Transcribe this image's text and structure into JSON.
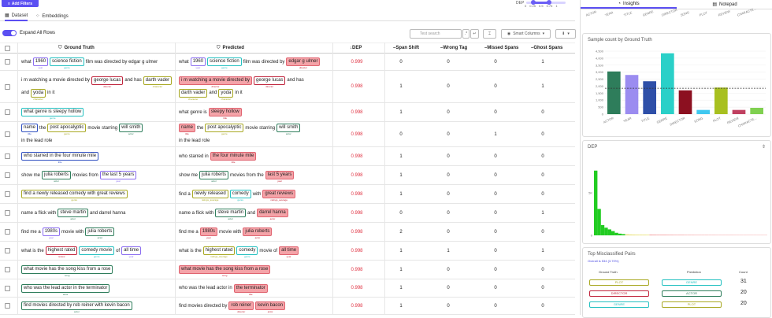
{
  "top": {
    "add_filters": "Add Filters",
    "dep_label": "DEP",
    "dep_ticks": [
      "0",
      "0.25",
      "0.5",
      "0.75",
      "1"
    ],
    "dep_range": [
      0.25,
      0.75
    ]
  },
  "tabs": [
    {
      "label": "Dataset",
      "icon": "table-icon"
    },
    {
      "label": "Embeddings",
      "icon": "embeddings-icon"
    }
  ],
  "toolbar": {
    "expand_label": "Expand All Rows",
    "search_placeholder": "Test search",
    "smart_columns": "Smart Columns"
  },
  "columns": {
    "ground_truth": "Ground Truth",
    "predicted": "Predicted",
    "dep": "DEP",
    "span_shift": "Span Shift",
    "wrong_tag": "Wrong Tag",
    "missed_spans": "Missed Spans",
    "ghost_spans": "Ghost Spans"
  },
  "rows": [
    {
      "gt": [
        [
          "t",
          "what"
        ],
        [
          "s",
          "1960",
          "year",
          "#8a6cf0"
        ],
        [
          "s",
          "science fiction",
          "genre",
          "#23c0c0"
        ],
        [
          "t",
          "film was directed by edgar g ulmer"
        ]
      ],
      "pr": [
        [
          "t",
          "what"
        ],
        [
          "s",
          "1960",
          "year",
          "#8a6cf0"
        ],
        [
          "s",
          "science fiction",
          "genre",
          "#23c0c0"
        ],
        [
          "t",
          "film was directed by"
        ],
        [
          "e",
          "edgar g ulmer",
          "director"
        ]
      ],
      "dep": "0.999",
      "ss": "0",
      "wt": "0",
      "ms": "0",
      "gs": "1"
    },
    {
      "gt": [
        [
          "t",
          "i m watching a movie directed by"
        ],
        [
          "s",
          "george lucas",
          "director",
          "#c0243c"
        ],
        [
          "t",
          "and has"
        ],
        [
          "s",
          "darth vader",
          "character",
          "#a8a822"
        ],
        [
          "t",
          "and"
        ],
        [
          "s",
          "yoda",
          "character",
          "#a8a822"
        ],
        [
          "t",
          "in it"
        ]
      ],
      "pr": [
        [
          "e",
          "i m watching a movie directed by",
          "director"
        ],
        [
          "s",
          "george lucas",
          "director",
          "#c0243c"
        ],
        [
          "t",
          "and has"
        ],
        [
          "s",
          "darth vader",
          "character",
          "#a8a822"
        ],
        [
          "t",
          "and"
        ],
        [
          "s",
          "yoda",
          "character",
          "#a8a822"
        ],
        [
          "t",
          "in it"
        ]
      ],
      "dep": "0.998",
      "ss": "1",
      "wt": "0",
      "ms": "0",
      "gs": "1"
    },
    {
      "gt": [
        [
          "s",
          "what genre is sleepy hollow",
          "genre",
          "#23c0c0"
        ]
      ],
      "pr": [
        [
          "t",
          "what genre is"
        ],
        [
          "e",
          "sleepy hollow",
          "title"
        ]
      ],
      "dep": "0.998",
      "ss": "1",
      "wt": "0",
      "ms": "0",
      "gs": "0"
    },
    {
      "gt": [
        [
          "s",
          "name",
          "title",
          "#3050c0"
        ],
        [
          "t",
          "the"
        ],
        [
          "s",
          "post apocalyptic",
          "genre",
          "#a8a822"
        ],
        [
          "t",
          "movie starring"
        ],
        [
          "s",
          "will smith",
          "actor",
          "#2e7d5b"
        ],
        [
          "t",
          "in the lead role"
        ]
      ],
      "pr": [
        [
          "e",
          "name",
          "title"
        ],
        [
          "t",
          "the"
        ],
        [
          "s",
          "post apocalyptic",
          "genre",
          "#a8a822"
        ],
        [
          "t",
          "movie starring"
        ],
        [
          "s",
          "will smith",
          "actor",
          "#2e7d5b"
        ],
        [
          "t",
          "in the lead role"
        ]
      ],
      "dep": "0.998",
      "ss": "0",
      "wt": "0",
      "ms": "1",
      "gs": "0"
    },
    {
      "gt": [
        [
          "s",
          "who starred in the four minute mile",
          "title",
          "#3050c0"
        ]
      ],
      "pr": [
        [
          "t",
          "who starred in"
        ],
        [
          "e",
          "the four minute mile",
          "title"
        ]
      ],
      "dep": "0.998",
      "ss": "1",
      "wt": "0",
      "ms": "0",
      "gs": "0"
    },
    {
      "gt": [
        [
          "t",
          "show me"
        ],
        [
          "s",
          "julia roberts",
          "actor",
          "#2e7d5b"
        ],
        [
          "t",
          "movies from"
        ],
        [
          "s",
          "the last 5 years",
          "year",
          "#8a6cf0"
        ]
      ],
      "pr": [
        [
          "t",
          "show me"
        ],
        [
          "s",
          "julia roberts",
          "actor",
          "#2e7d5b"
        ],
        [
          "t",
          "movies from the"
        ],
        [
          "e",
          "last 5 years",
          "year"
        ]
      ],
      "dep": "0.998",
      "ss": "1",
      "wt": "0",
      "ms": "0",
      "gs": "0"
    },
    {
      "gt": [
        [
          "s",
          "find a newly released comedy with great reviews",
          "genre",
          "#a8a822"
        ]
      ],
      "pr": [
        [
          "t",
          "find a"
        ],
        [
          "s",
          "newly released",
          "ratings_average",
          "#a8a822"
        ],
        [
          "s",
          "comedy",
          "genre",
          "#23c0c0"
        ],
        [
          "t",
          "with"
        ],
        [
          "e",
          "great reviews",
          "ratings_average"
        ]
      ],
      "dep": "0.998",
      "ss": "1",
      "wt": "0",
      "ms": "0",
      "gs": "0"
    },
    {
      "gt": [
        [
          "t",
          "name a flick with"
        ],
        [
          "s",
          "steve martin",
          "actor",
          "#2e7d5b"
        ],
        [
          "t",
          "and darrel hanna"
        ]
      ],
      "pr": [
        [
          "t",
          "name a flick with"
        ],
        [
          "s",
          "steve martin",
          "actor",
          "#2e7d5b"
        ],
        [
          "t",
          "and"
        ],
        [
          "e",
          "darrel hanna",
          "actor"
        ]
      ],
      "dep": "0.998",
      "ss": "0",
      "wt": "0",
      "ms": "0",
      "gs": "1"
    },
    {
      "gt": [
        [
          "t",
          "find me a"
        ],
        [
          "s",
          "1980s",
          "year",
          "#8a6cf0"
        ],
        [
          "t",
          "movie with"
        ],
        [
          "s",
          "julia roberts",
          "actor",
          "#2e7d5b"
        ]
      ],
      "pr": [
        [
          "t",
          "find me a"
        ],
        [
          "e",
          "1980s",
          "year"
        ],
        [
          "t",
          "movie with"
        ],
        [
          "e",
          "julia roberts",
          "actor"
        ]
      ],
      "dep": "0.998",
      "ss": "2",
      "wt": "0",
      "ms": "0",
      "gs": "0"
    },
    {
      "gt": [
        [
          "t",
          "what is the"
        ],
        [
          "s",
          "highest rated",
          "review",
          "#c0243c"
        ],
        [
          "s",
          "comedy movie",
          "genre",
          "#23c0c0"
        ],
        [
          "t",
          "of"
        ],
        [
          "s",
          "all time",
          "year",
          "#8a6cf0"
        ]
      ],
      "pr": [
        [
          "t",
          "what is the"
        ],
        [
          "s",
          "highest rated",
          "ratings_average",
          "#a8a822"
        ],
        [
          "s",
          "comedy",
          "genre",
          "#23c0c0"
        ],
        [
          "t",
          "movie of"
        ],
        [
          "e",
          "all time",
          "year"
        ]
      ],
      "dep": "0.998",
      "ss": "1",
      "wt": "1",
      "ms": "0",
      "gs": "1"
    },
    {
      "gt": [
        [
          "s",
          "what movie has the song kiss from a rose",
          "song",
          "#2e7d5b"
        ]
      ],
      "pr": [
        [
          "e",
          "what movie has the song kiss from a rose",
          "song"
        ]
      ],
      "dep": "0.998",
      "ss": "1",
      "wt": "0",
      "ms": "0",
      "gs": "0"
    },
    {
      "gt": [
        [
          "s",
          "who was the lead actor in the terminator",
          "actor",
          "#2e7d5b"
        ]
      ],
      "pr": [
        [
          "t",
          "who was the lead actor in"
        ],
        [
          "e",
          "the terminator",
          "title"
        ]
      ],
      "dep": "0.998",
      "ss": "1",
      "wt": "0",
      "ms": "0",
      "gs": "0"
    },
    {
      "gt": [
        [
          "s",
          "find movies directed by rob reiner with kevin bacon",
          "actor",
          "#2e7d5b"
        ]
      ],
      "pr": [
        [
          "t",
          "find movies directed by"
        ],
        [
          "e",
          "rob reiner",
          "director"
        ],
        [
          "e",
          "kevin bacon",
          "actor"
        ]
      ],
      "dep": "0.998",
      "ss": "1",
      "wt": "0",
      "ms": "0",
      "gs": "0"
    }
  ],
  "right": {
    "tabs": [
      "Insights",
      "Notepad"
    ],
    "mini_labels": [
      "ACTOR",
      "YEAR",
      "TITLE",
      "GENRE",
      "DIRECTOR",
      "SONG",
      "PLOT",
      "REVIEW",
      "CHARACTE..."
    ],
    "count_title": "Sample count by Ground Truth",
    "dep_title": "DEP",
    "misclassified_title": "Top Misclassified Pairs",
    "overall": "Overall is 534 (3.70%)",
    "pair_headers": [
      "Ground Truth",
      "Prediction",
      "Count"
    ],
    "pairs": [
      {
        "gt": "PLOT",
        "pr": "GENRE",
        "count": "31",
        "gc": "#a8a822",
        "pc": "#23c0c0"
      },
      {
        "gt": "DIRECTOR",
        "pr": "ACTOR",
        "count": "20",
        "gc": "#c0243c",
        "pc": "#2e7d5b"
      },
      {
        "gt": "GENRE",
        "pr": "PLOT",
        "count": "20",
        "gc": "#23c0c0",
        "pc": "#a8a822"
      }
    ]
  },
  "chart_data": [
    {
      "type": "bar",
      "title": "Sample count by Ground Truth",
      "categories": [
        "ACTOR",
        "YEAR",
        "TITLE",
        "GENRE",
        "DIRECTOR",
        "SONG",
        "PLOT",
        "REVIEW",
        "CHARACTE..."
      ],
      "values": [
        3050,
        2800,
        2350,
        4350,
        1700,
        300,
        1900,
        300,
        450
      ],
      "colors": [
        "#2e7d5b",
        "#9b8cf0",
        "#2e4fa8",
        "#2ad0c8",
        "#8c1020",
        "#40c8f0",
        "#a8c020",
        "#c04060",
        "#80d050"
      ],
      "ylim": [
        0,
        4500
      ],
      "yticks": [
        "0",
        "500",
        "1,000",
        "1,500",
        "2,000",
        "2,500",
        "3,000",
        "3,500",
        "4,000",
        "4,500"
      ],
      "reference_line": 1850
    },
    {
      "type": "bar",
      "title": "DEP",
      "yticks": [
        "0",
        "5K"
      ],
      "values": [
        7600,
        3100,
        1200,
        900,
        700,
        500,
        300,
        200,
        150,
        120,
        100,
        90,
        80,
        80,
        75,
        70,
        70,
        65,
        60,
        60,
        60,
        55,
        55,
        50,
        50,
        50,
        45,
        45,
        45,
        40,
        40,
        40,
        40,
        38,
        38,
        36,
        36,
        35,
        35,
        35,
        34,
        34,
        33,
        33,
        32,
        32,
        32,
        31,
        31,
        30
      ],
      "ylim": [
        0,
        8500
      ]
    }
  ]
}
